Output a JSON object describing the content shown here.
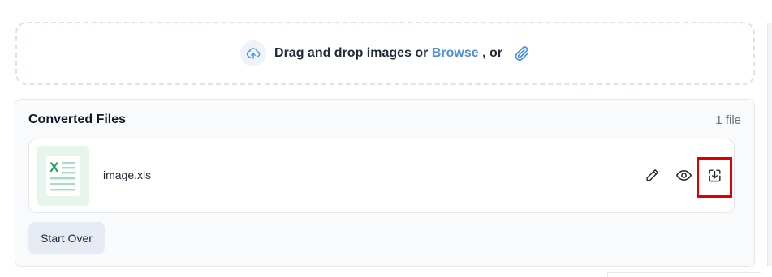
{
  "dropzone": {
    "text": "Drag and drop images or",
    "browse_label": "Browse",
    "suffix": ", or"
  },
  "converted": {
    "title": "Converted Files",
    "count": "1 file",
    "files": [
      {
        "name": "image.xls",
        "icon": "excel-file-icon"
      }
    ]
  },
  "actions": {
    "start_over_label": "Start Over",
    "file_actions": [
      "edit-icon",
      "eye-icon",
      "download-icon"
    ]
  },
  "colors": {
    "accent": "#4a90d9",
    "excel_green": "#21a366",
    "highlight": "#e00000"
  }
}
